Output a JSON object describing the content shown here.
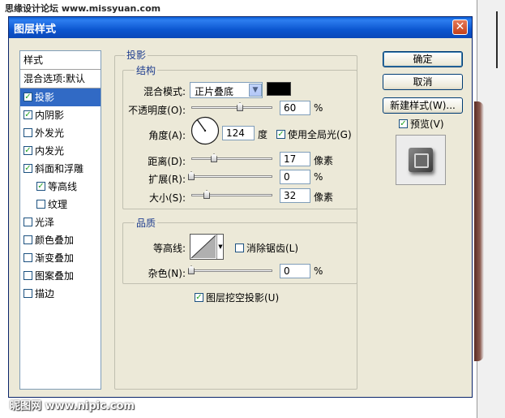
{
  "watermarks": {
    "top": "思缘设计论坛 www.missyuan.com",
    "bottom": "昵图网 www.nipic.com"
  },
  "dialog": {
    "title": "图层样式",
    "close_glyph": "✕"
  },
  "styles_list": {
    "header": "样式",
    "blend_options": "混合选项:默认",
    "items": [
      {
        "label": "投影",
        "checked": true,
        "selected": true
      },
      {
        "label": "内阴影",
        "checked": true
      },
      {
        "label": "外发光",
        "checked": false
      },
      {
        "label": "内发光",
        "checked": true
      },
      {
        "label": "斜面和浮雕",
        "checked": true
      },
      {
        "label": "等高线",
        "checked": true,
        "indent": true
      },
      {
        "label": "纹理",
        "checked": false,
        "indent": true
      },
      {
        "label": "光泽",
        "checked": false
      },
      {
        "label": "颜色叠加",
        "checked": false
      },
      {
        "label": "渐变叠加",
        "checked": false
      },
      {
        "label": "图案叠加",
        "checked": false
      },
      {
        "label": "描边",
        "checked": false
      }
    ]
  },
  "drop_shadow": {
    "section_title": "投影",
    "structure": {
      "title": "结构",
      "blend_mode_label": "混合模式:",
      "blend_mode_value": "正片叠底",
      "blend_color": "#000000",
      "opacity_label": "不透明度(O):",
      "opacity_value": "60",
      "opacity_unit": "%",
      "opacity_level": 0.6,
      "angle_label": "角度(A):",
      "angle_value": "124",
      "angle_unit": "度",
      "global_light_label": "使用全局光(G)",
      "global_light_checked": true,
      "distance_label": "距离(D):",
      "distance_value": "17",
      "distance_unit": "像素",
      "distance_level": 0.17,
      "spread_label": "扩展(R):",
      "spread_value": "0",
      "spread_unit": "%",
      "spread_level": 0,
      "size_label": "大小(S):",
      "size_value": "32",
      "size_unit": "像素",
      "size_level": 0.13
    },
    "quality": {
      "title": "品质",
      "contour_label": "等高线:",
      "anti_alias_label": "消除锯齿(L)",
      "anti_alias_checked": false,
      "noise_label": "杂色(N):",
      "noise_value": "0",
      "noise_unit": "%",
      "noise_level": 0
    },
    "knockout_label": "图层挖空投影(U)",
    "knockout_checked": true
  },
  "buttons": {
    "ok": "确定",
    "cancel": "取消",
    "new_style": "新建样式(W)...",
    "preview_label": "预览(V)",
    "preview_checked": true
  },
  "colors": {
    "title_bar": "#0a5fd8",
    "selection": "#316ac5",
    "group_title": "#1e3d8e",
    "dialog_bg": "#ece9d8"
  }
}
